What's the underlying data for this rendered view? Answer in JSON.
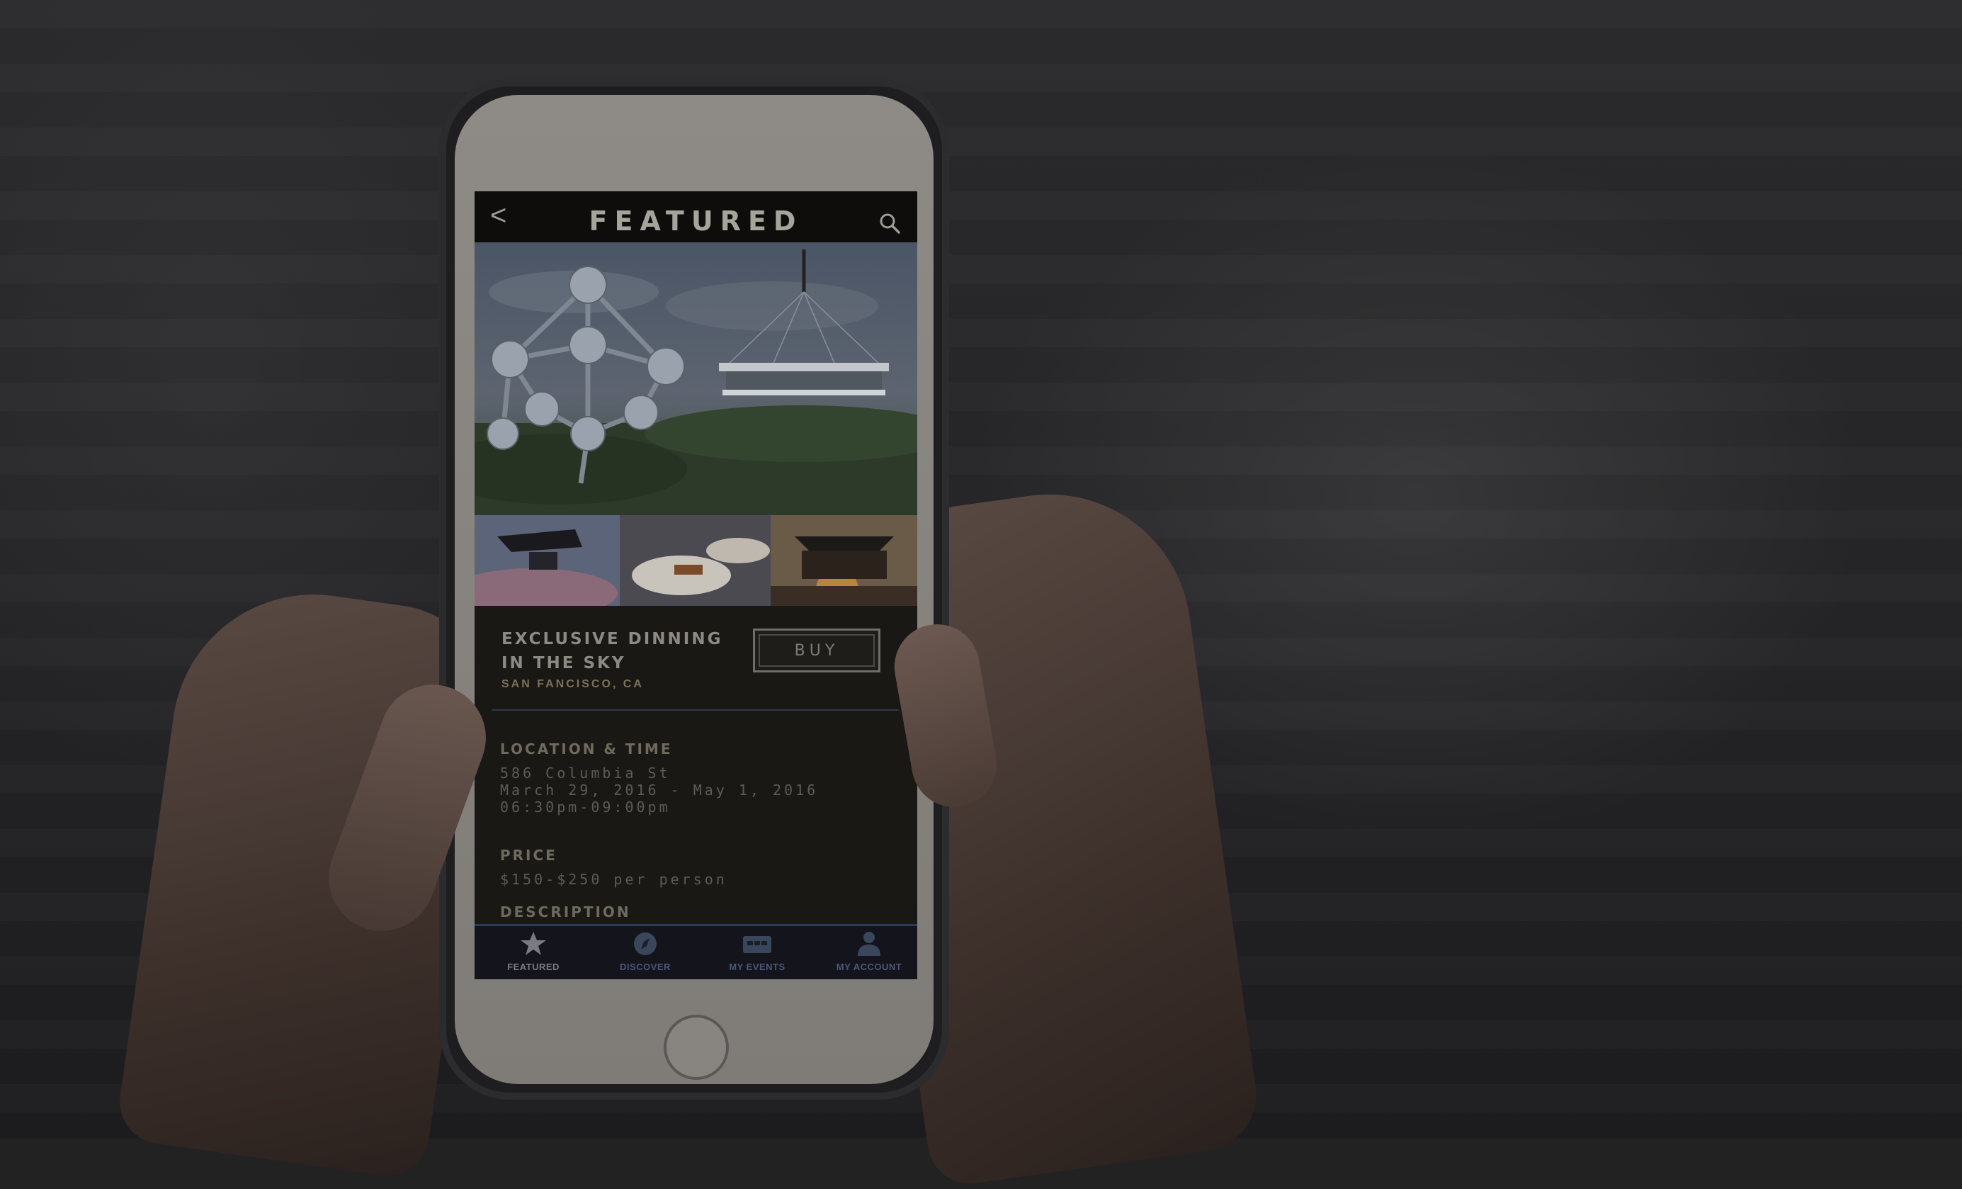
{
  "header": {
    "back_symbol": "<",
    "title": "FEATURED"
  },
  "event": {
    "title": "EXCLUSIVE DINNING IN THE SKY",
    "city": "SAN FANCISCO, CA",
    "buy_label": "BUY"
  },
  "details": {
    "location_heading": "LOCATION & TIME",
    "address": "586 Columbia St",
    "dates": "March 29, 2016 - May 1, 2016",
    "hours": "06:30pm-09:00pm",
    "price_heading": "PRICE",
    "price": "$150-$250 per person",
    "description_heading": "DESCRIPTION"
  },
  "tabs": [
    {
      "label": "FEATURED",
      "icon": "star-icon",
      "active": true
    },
    {
      "label": "DISCOVER",
      "icon": "compass-icon",
      "active": false
    },
    {
      "label": "MY EVENTS",
      "icon": "ticket-icon",
      "active": false
    },
    {
      "label": "MY ACCOUNT",
      "icon": "person-icon",
      "active": false
    }
  ],
  "colors": {
    "screen_bg": "#1a1814",
    "tabbar_bg": "#14151c",
    "accent_blue": "#2c3b57"
  }
}
